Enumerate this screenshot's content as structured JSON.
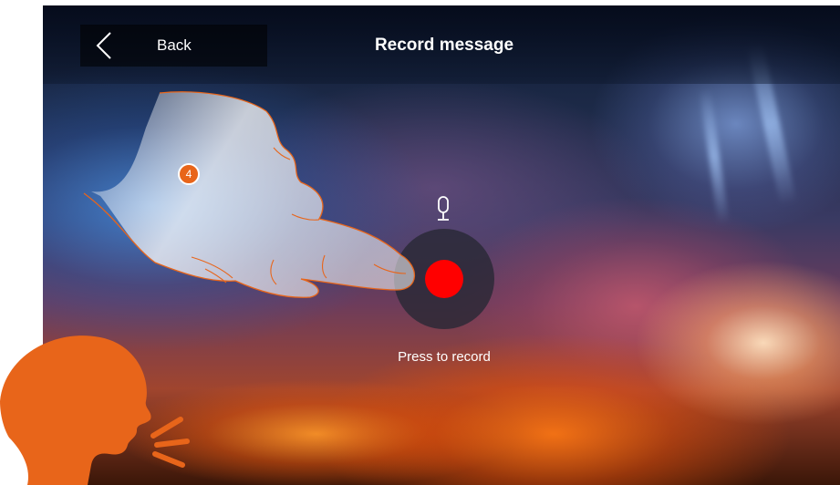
{
  "header": {
    "back_label": "Back",
    "title": "Record message"
  },
  "recorder": {
    "label": "Press to record",
    "icon": "microphone-icon"
  },
  "step_badge": {
    "number": "4"
  },
  "colors": {
    "accent_orange": "#e8651a",
    "record_red": "#ff0000",
    "button_ring": "#2a2a36",
    "text": "#ffffff"
  }
}
